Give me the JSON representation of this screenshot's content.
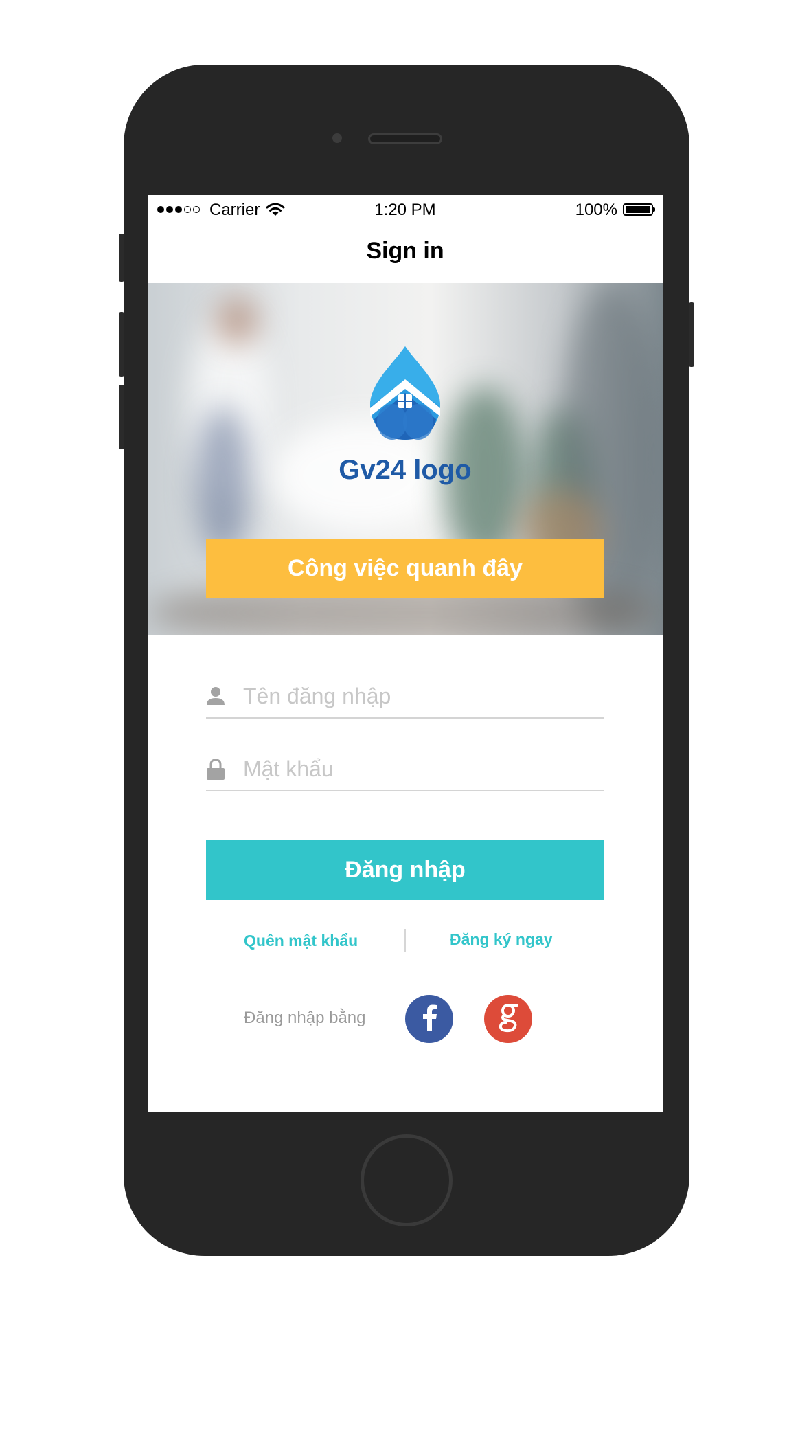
{
  "status_bar": {
    "carrier": "Carrier",
    "time": "1:20 PM",
    "battery": "100%"
  },
  "nav": {
    "title": "Sign in"
  },
  "hero": {
    "logo_text": "Gv24 logo",
    "nearby_button": "Công việc quanh đây"
  },
  "form": {
    "username_placeholder": "Tên đăng nhập",
    "password_placeholder": "Mật khẩu",
    "login_button": "Đăng nhập"
  },
  "links": {
    "forgot_password": "Quên mật khẩu",
    "register": "Đăng ký ngay"
  },
  "social": {
    "label": "Đăng nhập bằng",
    "facebook_icon": "facebook-icon",
    "google_icon": "google-icon"
  },
  "colors": {
    "accent": "#32c5ca",
    "hero_button": "#fdbe3f",
    "logo_blue": "#1f5aa6",
    "facebook": "#3b5aa2",
    "google": "#dd4b39"
  }
}
